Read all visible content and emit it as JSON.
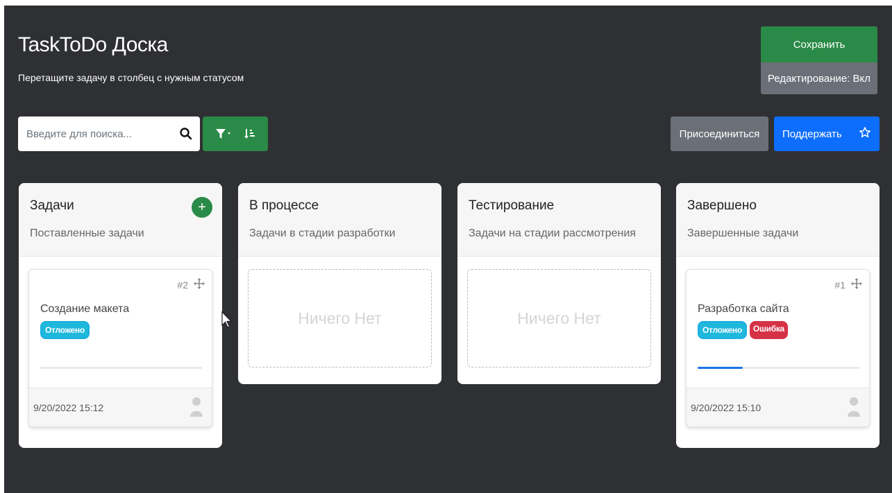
{
  "header": {
    "title": "TaskToDo Доска",
    "subtitle": "Перетащите задачу в столбец с нужным статусом",
    "save_label": "Сохранить",
    "edit_label": "Редактирование: Вкл"
  },
  "toolbar": {
    "search_placeholder": "Введите для поиска...",
    "join_label": "Присоединиться",
    "support_label": "Поддержать",
    "icons": [
      "search-icon",
      "filter-icon",
      "sort-icon",
      "star-icon"
    ]
  },
  "columns": [
    {
      "title": "Задачи",
      "subtitle": "Поставленные задачи",
      "cards": [
        {
          "id": "#2",
          "title": "Создание макета",
          "tags": [
            "Отложено"
          ],
          "progress": 0,
          "date": "9/20/2022 15:12"
        }
      ]
    },
    {
      "title": "В процессе",
      "subtitle": "Задачи в стадии разработки",
      "empty_text": "Ничего Нет"
    },
    {
      "title": "Тестирование",
      "subtitle": "Задачи на стадии рассмотрения",
      "empty_text": "Ничего Нет"
    },
    {
      "title": "Завершено",
      "subtitle": "Завершенные задачи",
      "cards": [
        {
          "id": "#1",
          "title": "Разработка сайта",
          "tags": [
            "Отложено",
            "Ошибка"
          ],
          "progress": 0.28,
          "date": "9/20/2022 15:10"
        }
      ]
    }
  ],
  "colors": {
    "background": "#2f3033",
    "success": "#2a8a47",
    "secondary": "#6b7078",
    "primary": "#0d6efd",
    "info_badge": "#1fb8dd",
    "danger_badge": "#d63246"
  }
}
